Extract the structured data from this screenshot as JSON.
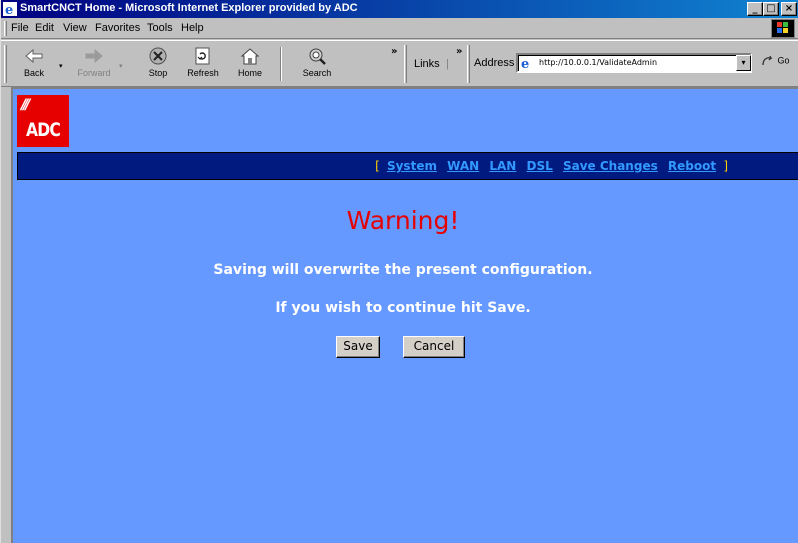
{
  "window": {
    "title": "SmartCNCT Home - Microsoft Internet Explorer provided by ADC",
    "minimize_glyph": "_",
    "maximize_glyph": "□",
    "close_glyph": "×"
  },
  "menu": [
    "File",
    "Edit",
    "View",
    "Favorites",
    "Tools",
    "Help"
  ],
  "toolbar": {
    "back_label": "Back",
    "forward_label": "Forward",
    "stop_label": "Stop",
    "refresh_label": "Refresh",
    "home_label": "Home",
    "search_label": "Search",
    "chevron": "»",
    "links_label": "Links",
    "links_sep": "|",
    "address_label": "Address",
    "address_url": "http://10.0.0.1/ValidateAdmin",
    "go_label": "Go",
    "dropdown_glyph": "▾"
  },
  "logo": {
    "text": "ADC",
    "slashes": "///",
    "color": "#e60000"
  },
  "nav": {
    "open_bracket": "[",
    "close_bracket": "]",
    "links": [
      "System",
      "WAN",
      "LAN",
      "DSL",
      "Save Changes",
      "Reboot"
    ]
  },
  "page": {
    "heading": "Warning!",
    "message1": "Saving will overwrite the present configuration.",
    "message2": "If you wish to continue hit Save.",
    "save_label": "Save",
    "cancel_label": "Cancel"
  },
  "colors": {
    "page_background": "#6699ff",
    "navbar_background": "#001a80",
    "warning_red": "#e60000",
    "link_blue": "#3399ff",
    "bracket_gold": "#ffcc00"
  }
}
